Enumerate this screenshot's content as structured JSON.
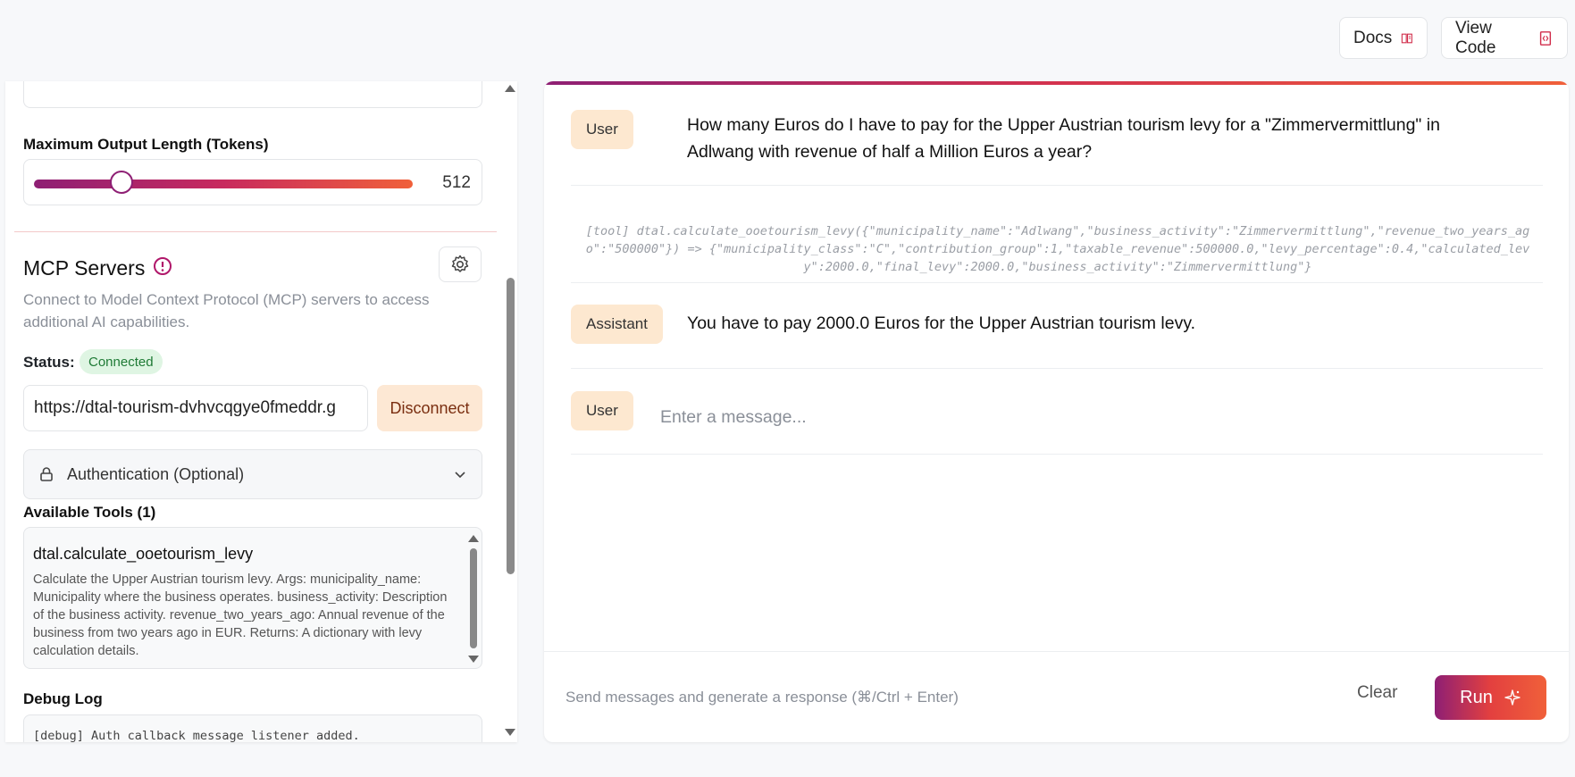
{
  "header": {
    "docs_label": "Docs",
    "view_code_label": "View Code"
  },
  "settings": {
    "max_output_label": "Maximum Output Length (Tokens)",
    "max_output_value": "512",
    "max_output_fraction": 0.23
  },
  "mcp": {
    "title": "MCP Servers",
    "description": "Connect to Model Context Protocol (MCP) servers to access additional AI capabilities.",
    "status_label": "Status:",
    "status_value": "Connected",
    "url": "https://dtal-tourism-dvhvcqgye0fmeddr.g",
    "disconnect_label": "Disconnect",
    "auth_label": "Authentication (Optional)",
    "tools_label": "Available Tools (1)",
    "tools": [
      {
        "name": "dtal.calculate_ooetourism_levy",
        "description": "Calculate the Upper Austrian tourism levy. Args: municipality_name: Municipality where the business operates. business_activity: Description of the business activity. revenue_two_years_ago: Annual revenue of the business from two years ago in EUR. Returns: A dictionary with levy calculation details."
      }
    ],
    "debug_label": "Debug Log",
    "debug_line": "[debug] Auth callback message listener added."
  },
  "chat": {
    "messages": [
      {
        "role": "User",
        "text": "How many Euros do I have to pay for the Upper Austrian tourism levy for a \"Zimmervermittlung\" in Adlwang with revenue of half a Million Euros a year?"
      },
      {
        "role": "Assistant",
        "text": "You have to pay 2000.0 Euros for the Upper Austrian tourism levy."
      }
    ],
    "tool_call": "[tool] dtal.calculate_ooetourism_levy({\"municipality_name\":\"Adlwang\",\"business_activity\":\"Zimmervermittlung\",\"revenue_two_years_ago\":\"500000\"}) => {\"municipality_class\":\"C\",\"contribution_group\":1,\"taxable_revenue\":500000.0,\"levy_percentage\":0.4,\"calculated_levy\":2000.0,\"final_levy\":2000.0,\"business_activity\":\"Zimmervermittlung\"}",
    "input_role": "User",
    "input_placeholder": "Enter a message...",
    "footer_hint": "Send messages and generate a response (⌘/Ctrl + Enter)",
    "clear_label": "Clear",
    "run_label": "Run"
  },
  "colors": {
    "accent_start": "#8e1f74",
    "accent_end": "#f0603a",
    "connected_bg": "#dff5e3",
    "role_bg": "#fde8d0"
  }
}
